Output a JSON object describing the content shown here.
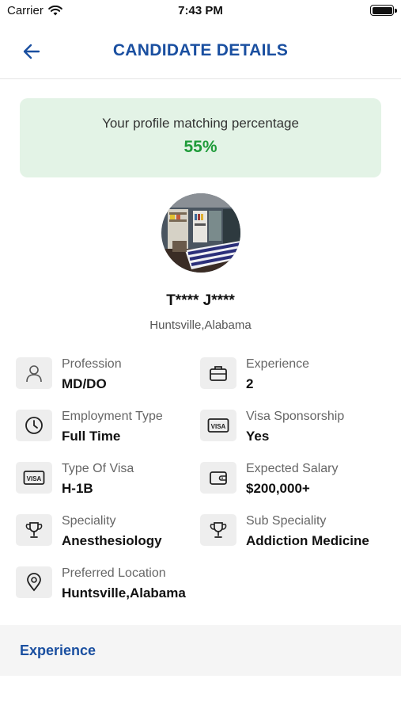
{
  "status_bar": {
    "carrier": "Carrier",
    "time": "7:43 PM"
  },
  "header": {
    "title": "CANDIDATE DETAILS",
    "back_icon": "arrow-left-icon"
  },
  "match": {
    "label": "Your profile matching percentage",
    "value": "55%",
    "color": "#1f9b3a",
    "background": "#e3f3e6"
  },
  "candidate": {
    "name": "T**** J****",
    "location": "Huntsville,Alabama"
  },
  "details": {
    "profession": {
      "label": "Profession",
      "value": "MD/DO",
      "icon": "person-icon"
    },
    "experience": {
      "label": "Experience",
      "value": "2",
      "icon": "briefcase-icon"
    },
    "employment_type": {
      "label": "Employment Type",
      "value": "Full Time",
      "icon": "clock-icon"
    },
    "visa_sponsorship": {
      "label": "Visa Sponsorship",
      "value": "Yes",
      "icon": "visa-icon"
    },
    "type_of_visa": {
      "label": "Type Of Visa",
      "value": "H-1B",
      "icon": "visa-icon"
    },
    "expected_salary": {
      "label": "Expected Salary",
      "value": "$200,000+",
      "icon": "wallet-icon"
    },
    "speciality": {
      "label": "Speciality",
      "value": "Anesthesiology",
      "icon": "trophy-icon"
    },
    "sub_speciality": {
      "label": "Sub Speciality",
      "value": "Addiction Medicine",
      "icon": "trophy-icon"
    },
    "preferred_location": {
      "label": "Preferred Location",
      "value": "Huntsville,Alabama",
      "icon": "location-pin-icon"
    }
  },
  "sections": {
    "experience_title": "Experience"
  },
  "colors": {
    "accent": "#1a4fa0",
    "text": "#111111",
    "muted": "#666666"
  }
}
